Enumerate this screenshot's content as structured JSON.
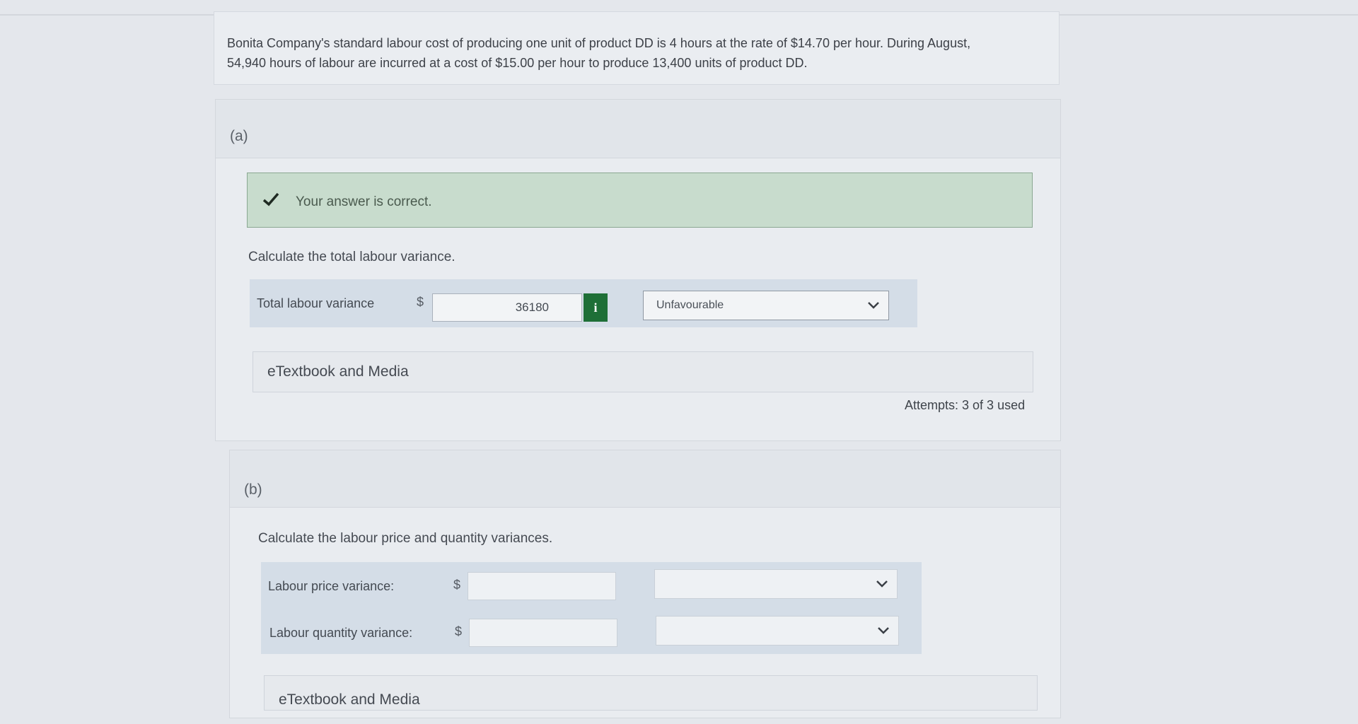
{
  "question": {
    "line1": "Bonita Company's standard labour cost of producing one unit of product DD is 4 hours at the rate of $14.70 per hour. During August,",
    "line2": "54,940 hours of labour are incurred at a cost of $15.00 per hour to produce 13,400 units of product DD."
  },
  "part_a": {
    "label": "(a)",
    "feedback": "Your answer is correct.",
    "instruction": "Calculate the total labour variance.",
    "row": {
      "label": "Total labour variance",
      "currency": "$",
      "value": "36180",
      "info_icon": "info-icon",
      "select_value": "Unfavourable"
    },
    "etextbook": "eTextbook and Media",
    "attempts": "Attempts: 3 of 3 used"
  },
  "part_b": {
    "label": "(b)",
    "instruction": "Calculate the labour price and quantity variances.",
    "rows": [
      {
        "label": "Labour price variance:",
        "currency": "$",
        "value": "",
        "select_value": ""
      },
      {
        "label": "Labour quantity variance:",
        "currency": "$",
        "value": "",
        "select_value": ""
      }
    ],
    "etextbook": "eTextbook and Media"
  },
  "colors": {
    "correct_bg": "#c8dccd",
    "info_green": "#1e6f37",
    "row_bg": "#d4dde7"
  }
}
